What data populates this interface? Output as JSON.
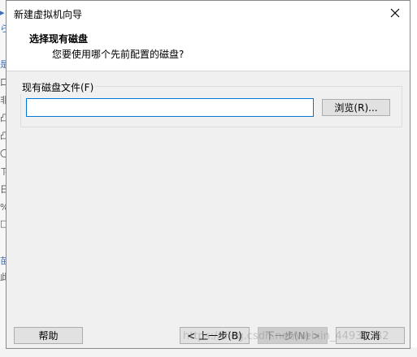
{
  "dialog": {
    "title": "新建虚拟机向导",
    "header_title": "选择现有磁盘",
    "header_subtitle": "您要使用哪个先前配置的磁盘?",
    "group_label": "现有磁盘文件(F)",
    "file_value": "",
    "browse_label": "浏览(R)..."
  },
  "footer": {
    "help_label": "帮助",
    "back_label": "< 上一步(B)",
    "next_label": "下一步(N) >",
    "cancel_label": "取消"
  },
  "background": {
    "left_glyphs": [
      "▸",
      "ら",
      "是",
      "口",
      "非",
      "凸",
      "凸",
      "〇",
      "ㄗ",
      "日",
      "%",
      "□",
      "苗",
      "此"
    ],
    "watermark": "https://blog.csdn.net/weixin_44932332"
  },
  "colors": {
    "accent": "#0078d7",
    "dialog_bg": "#f0f0f0",
    "header_bg": "#ffffff"
  }
}
